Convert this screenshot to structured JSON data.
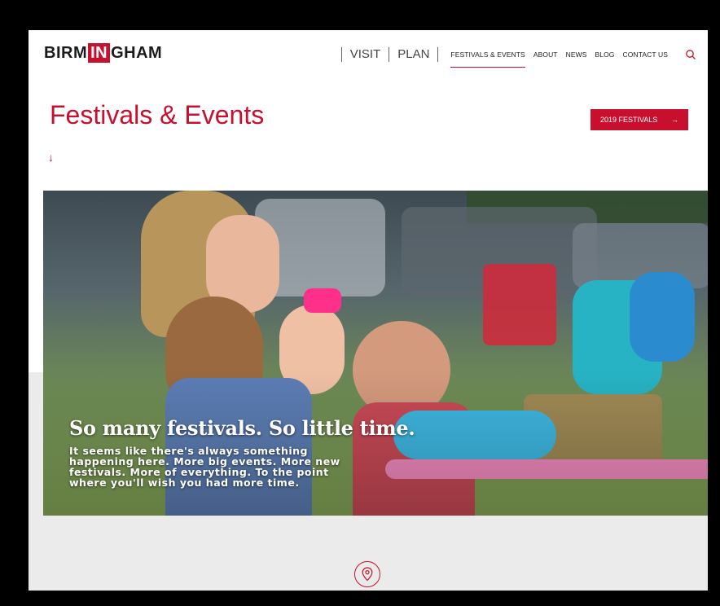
{
  "logo": {
    "part1": "BIRM",
    "part2": "IN",
    "part3": "GHAM"
  },
  "nav": {
    "big_links": [
      "VISIT",
      "PLAN"
    ],
    "links": [
      "FESTIVALS & EVENTS",
      "ABOUT",
      "NEWS",
      "BLOG",
      "CONTACT US"
    ],
    "active": "FESTIVALS & EVENTS"
  },
  "page": {
    "title": "Festivals & Events",
    "cta_label": "2019 FESTIVALS",
    "cta_arrow": "→",
    "down_arrow": "↓"
  },
  "hero": {
    "headline": "So many festivals. So little time.",
    "body": "It seems like there's always something happening here. More big events. More new festivals. More of everything. To the point where you'll wish you had more time."
  },
  "colors": {
    "accent": "#c8102e",
    "band": "#ebebeb"
  }
}
